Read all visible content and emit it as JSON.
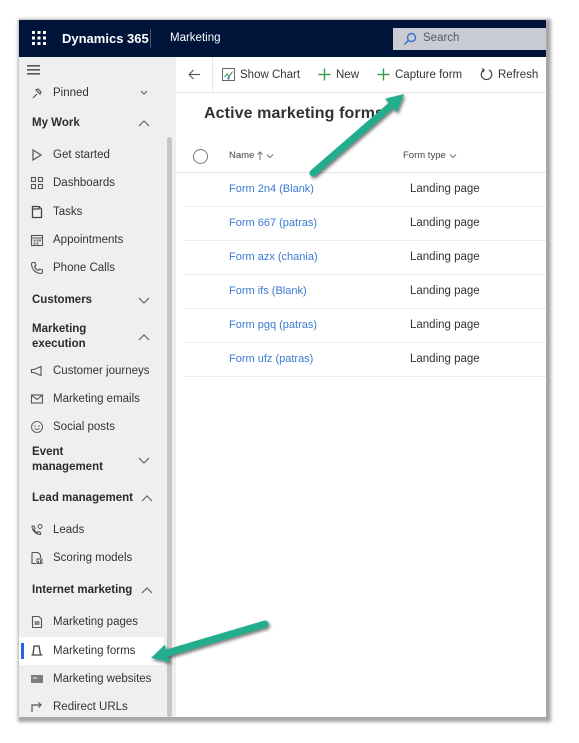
{
  "app": {
    "launcher_icon": "waffle-icon",
    "name": "Dynamics 365",
    "module": "Marketing"
  },
  "search": {
    "icon": "search-icon",
    "placeholder": "Search"
  },
  "sidebar": {
    "menu_icon": "hamburger-icon",
    "items": [
      {
        "type": "group",
        "label": "Pinned",
        "icon": "pin-icon",
        "state": "collapsed"
      },
      {
        "type": "group",
        "label": "My Work",
        "state": "expanded"
      },
      {
        "type": "item",
        "label": "Get started",
        "icon": "play-icon"
      },
      {
        "type": "item",
        "label": "Dashboards",
        "icon": "dashboard-icon"
      },
      {
        "type": "item",
        "label": "Tasks",
        "icon": "task-icon"
      },
      {
        "type": "item",
        "label": "Appointments",
        "icon": "calendar-icon"
      },
      {
        "type": "item",
        "label": "Phone Calls",
        "icon": "phone-icon"
      },
      {
        "type": "group",
        "label": "Customers",
        "state": "collapsed"
      },
      {
        "type": "group",
        "label": "Marketing execution",
        "state": "expanded"
      },
      {
        "type": "item",
        "label": "Customer journeys",
        "icon": "megaphone-icon"
      },
      {
        "type": "item",
        "label": "Marketing emails",
        "icon": "email-icon"
      },
      {
        "type": "item",
        "label": "Social posts",
        "icon": "social-icon"
      },
      {
        "type": "group",
        "label": "Event management",
        "state": "collapsed"
      },
      {
        "type": "group",
        "label": "Lead management",
        "state": "expanded"
      },
      {
        "type": "item",
        "label": "Leads",
        "icon": "leads-icon"
      },
      {
        "type": "item",
        "label": "Scoring models",
        "icon": "scoring-icon"
      },
      {
        "type": "group",
        "label": "Internet marketing",
        "state": "expanded"
      },
      {
        "type": "item",
        "label": "Marketing pages",
        "icon": "page-icon"
      },
      {
        "type": "item",
        "label": "Marketing forms",
        "icon": "form-icon",
        "selected": true
      },
      {
        "type": "item",
        "label": "Marketing websites",
        "icon": "website-icon"
      },
      {
        "type": "item",
        "label": "Redirect URLs",
        "icon": "redirect-icon"
      }
    ]
  },
  "toolbar": {
    "back_icon": "back-arrow-icon",
    "show_chart": "Show Chart",
    "new": "New",
    "capture_form": "Capture form",
    "refresh": "Refresh"
  },
  "page": {
    "title": "Active marketing forms"
  },
  "grid": {
    "columns": [
      {
        "label": "Name",
        "sort": "ascending"
      },
      {
        "label": "Form type"
      }
    ],
    "rows": [
      {
        "name": "Form 2n4 (Blank)",
        "form_type": "Landing page"
      },
      {
        "name": "Form 667 (patras)",
        "form_type": "Landing page"
      },
      {
        "name": "Form azx (chania)",
        "form_type": "Landing page"
      },
      {
        "name": "Form ifs (Blank)",
        "form_type": "Landing page"
      },
      {
        "name": "Form pgq (patras)",
        "form_type": "Landing page"
      },
      {
        "name": "Form ufz (patras)",
        "form_type": "Landing page"
      }
    ]
  },
  "annotations": [
    {
      "type": "arrow",
      "points_to": "Capture form"
    },
    {
      "type": "arrow",
      "points_to": "Marketing forms"
    }
  ],
  "colors": {
    "topbar": "#00143a",
    "selection_accent": "#2266e3",
    "link": "#3a7ad5",
    "add_icon": "#2e9d3f",
    "annotation_arrow": "#20ad8e"
  }
}
